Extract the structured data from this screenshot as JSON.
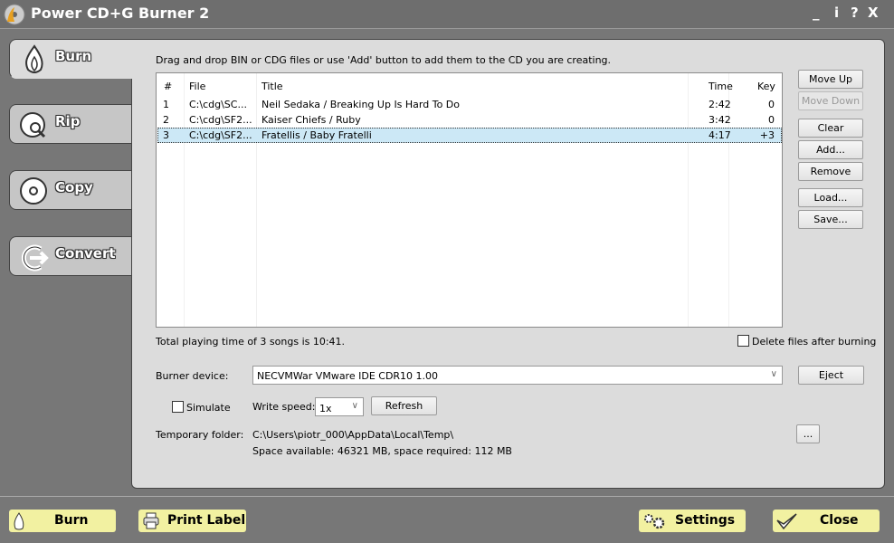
{
  "window": {
    "title": "Power CD+G Burner 2",
    "controls": [
      "_",
      "i",
      "?",
      "X"
    ]
  },
  "tabs": [
    {
      "label": "Burn",
      "icon": "flame-icon",
      "selected": true
    },
    {
      "label": "Rip",
      "icon": "disc-magnifier-icon"
    },
    {
      "label": "Copy",
      "icon": "disc-icon"
    },
    {
      "label": "Convert",
      "icon": "convert-arrow-icon"
    }
  ],
  "instructions": "Drag and drop BIN or CDG files or use 'Add' button to add them to the CD you are creating.",
  "list": {
    "columns": [
      "#",
      "File",
      "Title",
      "Time",
      "Key"
    ],
    "rows": [
      {
        "n": "1",
        "file": "C:\\cdg\\SC...",
        "title": "Neil Sedaka / Breaking Up Is Hard To Do",
        "time": "2:42",
        "key": "0"
      },
      {
        "n": "2",
        "file": "C:\\cdg\\SF2...",
        "title": "Kaiser Chiefs / Ruby",
        "time": "3:42",
        "key": "0"
      },
      {
        "n": "3",
        "file": "C:\\cdg\\SF2...",
        "title": "Fratellis / Baby Fratelli",
        "time": "4:17",
        "key": "+3",
        "selected": true
      }
    ]
  },
  "side_buttons": {
    "move_up": "Move Up",
    "move_down": "Move Down",
    "clear": "Clear",
    "add": "Add...",
    "remove": "Remove",
    "load": "Load...",
    "save": "Save..."
  },
  "total": "Total playing time of 3 songs is 10:41.",
  "delete_after": {
    "label": "Delete files after burning",
    "checked": false
  },
  "burner": {
    "label": "Burner device:",
    "value": "NECVMWar VMware IDE CDR10 1.00",
    "eject": "Eject"
  },
  "simulate": {
    "label": "Simulate",
    "checked": false
  },
  "write_speed": {
    "label": "Write speed:",
    "value": "1x",
    "refresh": "Refresh"
  },
  "temp": {
    "label": "Temporary folder:",
    "path": "C:\\Users\\piotr_000\\AppData\\Local\\Temp\\",
    "space": "Space available: 46321 MB, space required: 112 MB",
    "browse": "..."
  },
  "bottom": {
    "burn": "Burn",
    "print": "Print Label",
    "settings": "Settings",
    "close": "Close"
  },
  "colors": {
    "bottom_button": "#f2f1a1",
    "selection": "#cce8f6",
    "panel": "#dcdcdc",
    "frame": "#777777"
  }
}
